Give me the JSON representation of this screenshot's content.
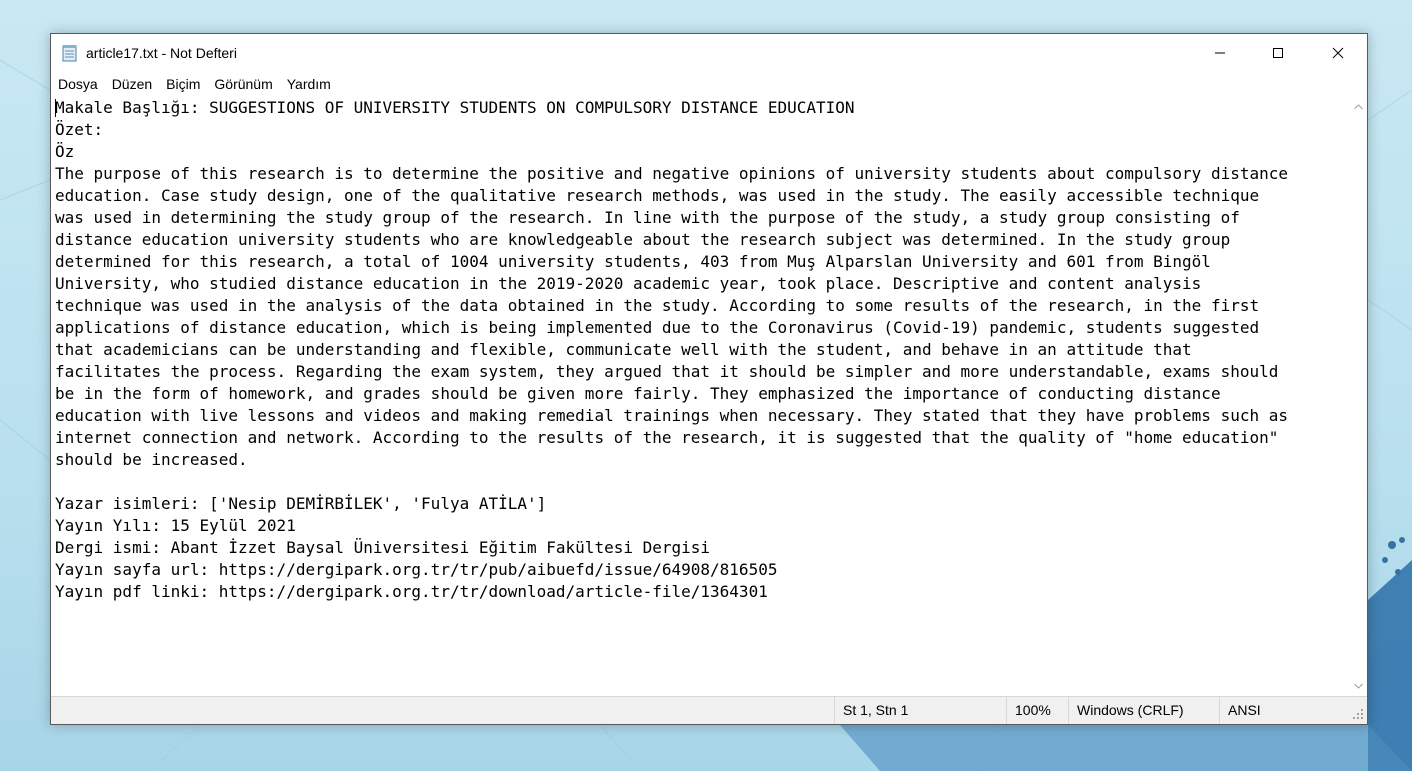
{
  "window": {
    "title": "article17.txt - Not Defteri",
    "icon": "notepad-icon",
    "controls": {
      "minimize": "minimize-icon",
      "maximize": "maximize-icon",
      "close": "close-icon"
    }
  },
  "menu": {
    "items": [
      "Dosya",
      "Düzen",
      "Biçim",
      "Görünüm",
      "Yardım"
    ]
  },
  "editor": {
    "lines": [
      "Makale Başlığı: SUGGESTIONS OF UNIVERSITY STUDENTS ON COMPULSORY DISTANCE EDUCATION",
      "Özet:",
      "Öz",
      "The purpose of this research is to determine the positive and negative opinions of university students about compulsory distance",
      "education. Case study design, one of the qualitative research methods, was used in the study. The easily accessible technique",
      "was used in determining the study group of the research. In line with the purpose of the study, a study group consisting of",
      "distance education university students who are knowledgeable about the research subject was determined. In the study group",
      "determined for this research, a total of 1004 university students, 403 from Muş Alparslan University and 601 from Bingöl",
      "University, who studied distance education in the 2019-2020 academic year, took place. Descriptive and content analysis",
      "technique was used in the analysis of the data obtained in the study. According to some results of the research, in the first",
      "applications of distance education, which is being implemented due to the Coronavirus (Covid-19) pandemic, students suggested",
      "that academicians can be understanding and flexible, communicate well with the student, and behave in an attitude that",
      "facilitates the process. Regarding the exam system, they argued that it should be simpler and more understandable, exams should",
      "be in the form of homework, and grades should be given more fairly. They emphasized the importance of conducting distance",
      "education with live lessons and videos and making remedial trainings when necessary. They stated that they have problems such as",
      "internet connection and network. According to the results of the research, it is suggested that the quality of \"home education\"",
      "should be increased.",
      "",
      "Yazar isimleri: ['Nesip DEMİRBİLEK', 'Fulya ATİLA']",
      "Yayın Yılı: 15 Eylül 2021",
      "Dergi ismi: Abant İzzet Baysal Üniversitesi Eğitim Fakültesi Dergisi",
      "Yayın sayfa url: https://dergipark.org.tr/tr/pub/aibuefd/issue/64908/816505",
      "Yayın pdf linki: https://dergipark.org.tr/tr/download/article-file/1364301"
    ]
  },
  "status": {
    "position": "St 1, Stn 1",
    "zoom": "100%",
    "line_ending": "Windows (CRLF)",
    "encoding": "ANSI"
  }
}
